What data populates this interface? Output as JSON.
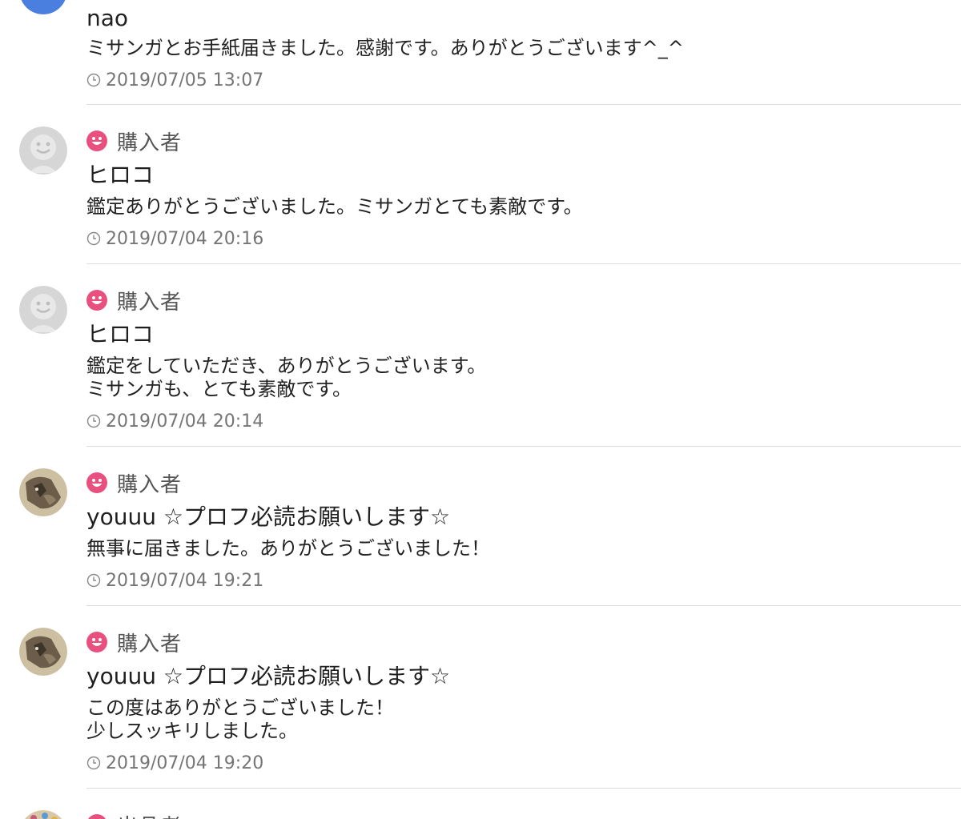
{
  "colors": {
    "role_icon": "#e9507f",
    "avatar_default": "#d6d6d6",
    "avatar_user": "#4a7fe0",
    "date_text": "#757575",
    "divider": "#dcdcdc"
  },
  "reviews": [
    {
      "role": "",
      "name": "nao",
      "message": "ミサンガとお手紙届きました。感謝です。ありがとうございます^_^",
      "date": "2019/07/05 13:07",
      "avatar": "blue-avatar"
    },
    {
      "role": "購入者",
      "name": "ヒロコ",
      "message": "鑑定ありがとうございました。ミサンガとても素敵です。",
      "date": "2019/07/04 20:16",
      "avatar": "default-avatar"
    },
    {
      "role": "購入者",
      "name": "ヒロコ",
      "message": "鑑定をしていただき、ありがとうございます。\nミサンガも、とても素敵です。",
      "date": "2019/07/04 20:14",
      "avatar": "default-avatar"
    },
    {
      "role": "購入者",
      "name": "youuu ☆プロフ必読お願いします☆",
      "message": "無事に届きました。ありがとうございました！",
      "date": "2019/07/04 19:21",
      "avatar": "cat-photo-avatar"
    },
    {
      "role": "購入者",
      "name": "youuu ☆プロフ必読お願いします☆",
      "message": "この度はありがとうございました！\n少しスッキリしました。",
      "date": "2019/07/04 19:20",
      "avatar": "cat-photo-avatar"
    },
    {
      "role": "出品者",
      "avatar": "seller-photo-avatar"
    }
  ]
}
